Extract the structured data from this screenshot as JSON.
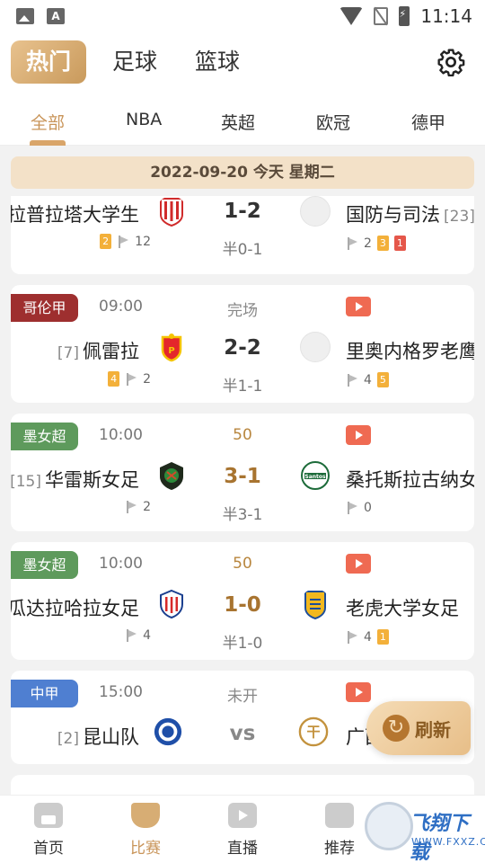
{
  "status_bar": {
    "time": "11:14"
  },
  "top_tabs": [
    {
      "label": "热门",
      "active": true
    },
    {
      "label": "足球",
      "active": false
    },
    {
      "label": "篮球",
      "active": false
    }
  ],
  "sub_tabs": [
    {
      "label": "全部",
      "active": true
    },
    {
      "label": "NBA",
      "active": false
    },
    {
      "label": "英超",
      "active": false
    },
    {
      "label": "欧冠",
      "active": false
    },
    {
      "label": "德甲",
      "active": false
    }
  ],
  "date_bar": "2022-09-20 今天 星期二",
  "matches": [
    {
      "home": "拉普拉塔大学生",
      "away": "国防与司法",
      "away_rank": "[23]",
      "score": "1-2",
      "half": "半0-1",
      "home_yellow": "2",
      "home_corners": "12",
      "away_corners": "2",
      "away_yellow": "3",
      "away_red": "1"
    },
    {
      "league": "哥伦甲",
      "league_color": "#9e2f2f",
      "time": "09:00",
      "status": "完场",
      "home": "佩雷拉",
      "home_rank": "[7]",
      "away": "里奥内格罗老鹰",
      "score": "2-2",
      "half": "半1-1",
      "home_yellow": "4",
      "home_corners": "2",
      "away_corners": "4",
      "away_yellow": "5"
    },
    {
      "league": "墨女超",
      "league_color": "#5e9a5c",
      "time": "10:00",
      "status": "50",
      "home": "华雷斯女足",
      "home_rank": "[15]",
      "away": "桑托斯拉古纳女足",
      "score": "3-1",
      "half": "半3-1",
      "home_corners": "2",
      "away_corners": "0"
    },
    {
      "league": "墨女超",
      "league_color": "#5e9a5c",
      "time": "10:00",
      "status": "50",
      "home": "瓜达拉哈拉女足",
      "away": "老虎大学女足",
      "score": "1-0",
      "half": "半1-0",
      "home_corners": "4",
      "away_corners": "4",
      "away_yellow": "1"
    },
    {
      "league": "中甲",
      "league_color": "#4f7fd1",
      "time": "15:00",
      "status": "未开",
      "home": "昆山队",
      "home_rank": "[2]",
      "away": "广西",
      "score": "vs"
    }
  ],
  "refresh_label": "刷新",
  "bottom_nav": [
    {
      "label": "首页",
      "icon": "home-icon",
      "active": false
    },
    {
      "label": "比赛",
      "icon": "trophy-icon",
      "active": true
    },
    {
      "label": "直播",
      "icon": "tv-play-icon",
      "active": false
    },
    {
      "label": "推荐",
      "icon": "recommend-icon",
      "active": false
    }
  ],
  "watermark": {
    "text": "飞翔下载",
    "url": "WWW.FXXZ.COM"
  },
  "colors": {
    "accent": "#c9955a",
    "live": "#a87430",
    "video": "#ef6a52"
  }
}
